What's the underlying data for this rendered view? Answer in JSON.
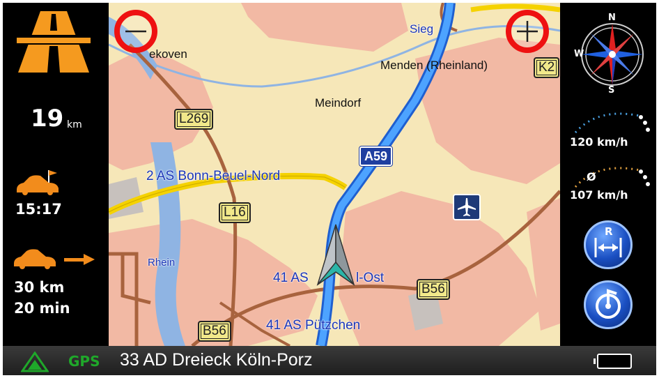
{
  "left_panel": {
    "distance_value": "19",
    "distance_unit": "km",
    "arrival_time": "15:17",
    "remaining_distance": "30 km",
    "remaining_time": "20 min"
  },
  "map": {
    "labels": {
      "siegburg_partial": "Sieg",
      "niederkassel_partial": "ekoven",
      "menden": "Menden (Rheinland)",
      "meindorf": "Meindorf",
      "rhein": "Rhein",
      "exit_bonn_beuel": "2 AS Bonn-Beuel-Nord",
      "exit_41_ost_prefix": "41 AS",
      "exit_41_ost_suffix": "l-Ost",
      "exit_puetzchen": "41 AS Pützchen"
    },
    "shields": {
      "l269": "L269",
      "l16": "L16",
      "a59": "A59",
      "b56_right": "B56",
      "b56_left": "B56",
      "k2": "K2"
    }
  },
  "right_panel": {
    "compass": {
      "n": "N",
      "s": "S",
      "w": "W"
    },
    "speed_limit": "120 km/h",
    "avg_symbol": "Ø",
    "avg_speed": "107 km/h",
    "reroute_letter": "R"
  },
  "status_bar": {
    "gps_label": "GPS",
    "next_instruction": "33 AD Dreieck Köln-Porz"
  },
  "colors": {
    "highway_orange": "#f59a1f",
    "car_orange": "#f28c1c",
    "gps_green": "#1fa82a",
    "zoom_red": "#e11111",
    "motorway_blue": "#4da3ff"
  }
}
